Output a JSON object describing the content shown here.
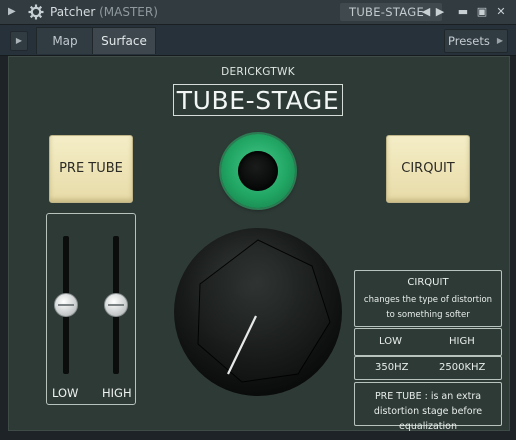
{
  "titlebar": {
    "app": "Patcher",
    "channel": "(MASTER)",
    "plugin": "TUBE-STAGE"
  },
  "toolbar": {
    "tabs": [
      "Map",
      "Surface"
    ],
    "presets_label": "Presets"
  },
  "plugin": {
    "author": "DERICKGTWK",
    "name": "TUBE-STAGE",
    "pre_tube_label": "PRE TUBE",
    "cirquit_label": "CIRQUIT",
    "slider_low_label": "LOW",
    "slider_high_label": "HIGH",
    "slider_low_level": 0.5,
    "slider_high_level": 0.5,
    "info": {
      "cirquit_title": "CIRQUIT",
      "cirquit_desc": "changes the type of distortion to something softer",
      "low": "LOW",
      "high": "HIGH",
      "low_freq": "350HZ",
      "high_freq": "2500KHZ",
      "pre_tube_desc": "PRE TUBE : is an extra distortion stage before equalization"
    }
  },
  "colors": {
    "panel": "#2e3a36",
    "pad": "#efe4b6",
    "led": "#21a563"
  },
  "icons": [
    "menu-arrow-icon",
    "gear-icon",
    "prev-icon",
    "next-icon",
    "minimize-icon",
    "maximize-icon",
    "close-icon"
  ]
}
